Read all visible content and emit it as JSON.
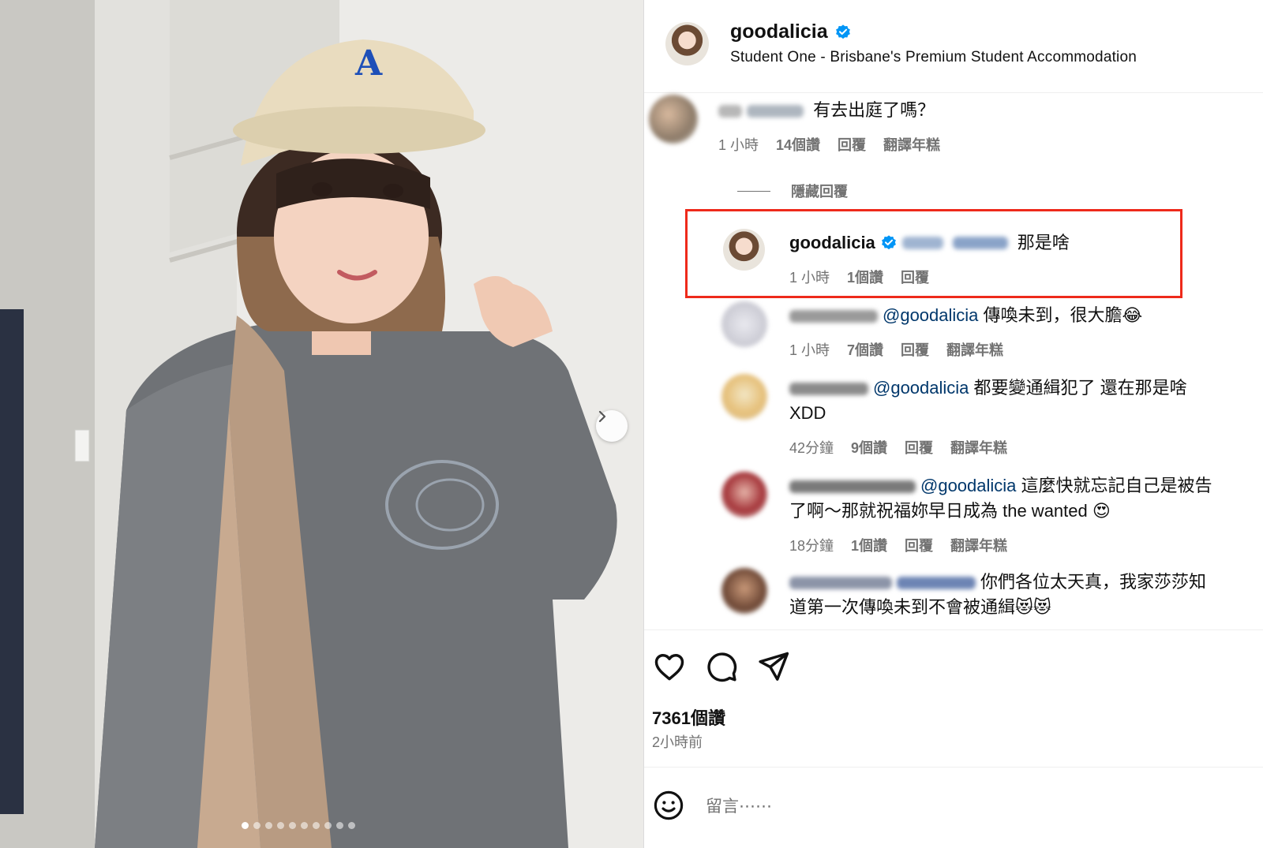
{
  "post": {
    "username": "goodalicia",
    "location": "Student One - Brisbane's Premium Student Accommodation",
    "carousel": {
      "total": 10,
      "active_index": 0
    },
    "likes_label": "7361個讚",
    "time_label": "2小時前"
  },
  "comments": [
    {
      "text": "有去出庭了嗎？",
      "time": "1 小時",
      "likes": "14個讚",
      "reply": "回覆",
      "translate": "翻譯年糕"
    },
    {
      "username": "goodalicia",
      "text": "那是啥",
      "time": "1 小時",
      "likes": "1個讚",
      "reply": "回覆",
      "highlighted": true
    },
    {
      "mention": "@goodalicia",
      "text": "傳喚未到，很大膽😂",
      "time": "1 小時",
      "likes": "7個讚",
      "reply": "回覆",
      "translate": "翻譯年糕"
    },
    {
      "mention": "@goodalicia",
      "text_line1": "都要變通緝犯了 還在那是啥",
      "text_line2": "XDD",
      "time": "42分鐘",
      "likes": "9個讚",
      "reply": "回覆",
      "translate": "翻譯年糕"
    },
    {
      "mention": "@goodalicia",
      "text_line1": "這麼快就忘記自己是被告",
      "text_line2": "了啊～那就祝福妳早日成為 the wanted 😍",
      "time": "18分鐘",
      "likes": "1個讚",
      "reply": "回覆",
      "translate": "翻譯年糕"
    },
    {
      "text_line1": "你們各位太天真，我家莎莎知",
      "text_line2": "道第一次傳喚未到不會被通緝😻😻"
    }
  ],
  "hide_replies_label": "隱藏回覆",
  "add_comment": {
    "placeholder": "留言⋯⋯"
  },
  "icons": {
    "verified": "verified-badge-icon",
    "like": "heart-icon",
    "comment": "comment-bubble-icon",
    "share": "send-icon",
    "emoji": "emoji-icon",
    "next": "chevron-right-icon"
  },
  "colors": {
    "verified_blue": "#0095f6",
    "mention_blue": "#00376b",
    "highlight_red": "#ee2a1b",
    "meta_gray": "#737373"
  }
}
